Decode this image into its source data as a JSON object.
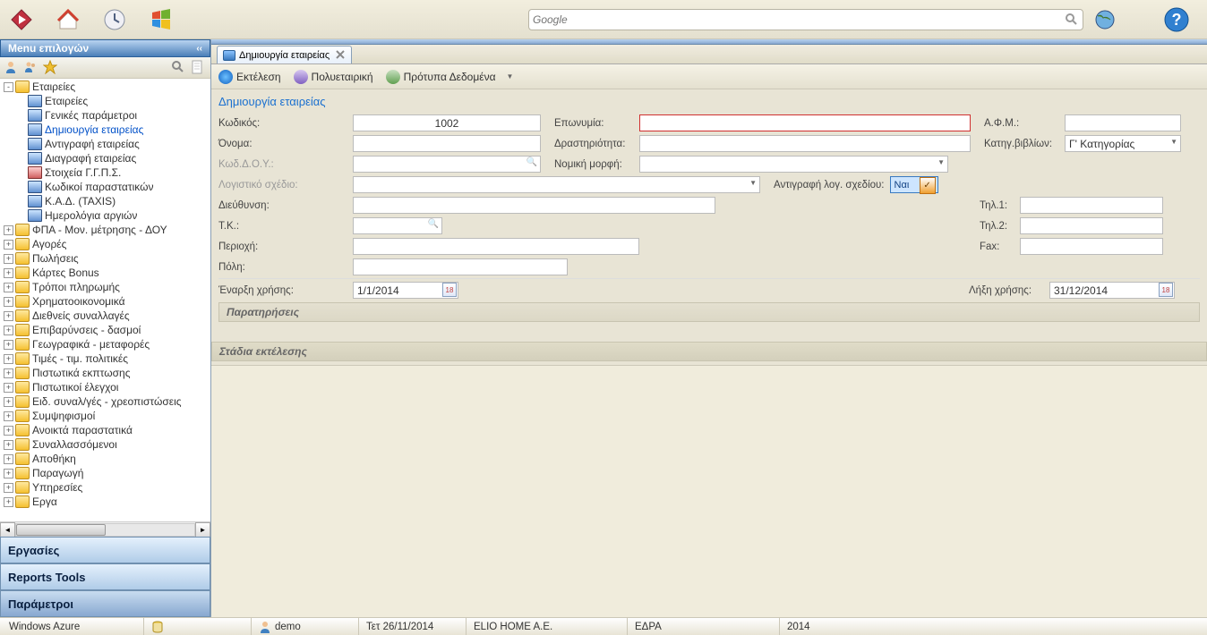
{
  "search": {
    "placeholder": "Google"
  },
  "sidebar": {
    "title": "Menu επιλογών",
    "accordion": [
      "Εργασίες",
      "Reports Tools",
      "Παράμετροι"
    ],
    "tree": [
      {
        "lvl": 1,
        "pm": "-",
        "type": "folder",
        "label": "Εταιρείες"
      },
      {
        "lvl": 2,
        "pm": "",
        "type": "doc",
        "label": "Εταιρείες"
      },
      {
        "lvl": 2,
        "pm": "",
        "type": "doc",
        "label": "Γενικές παράμετροι"
      },
      {
        "lvl": 2,
        "pm": "",
        "type": "doc",
        "label": "Δημιουργία εταιρείας",
        "selected": true
      },
      {
        "lvl": 2,
        "pm": "",
        "type": "doc",
        "label": "Αντιγραφή εταιρείας"
      },
      {
        "lvl": 2,
        "pm": "",
        "type": "doc",
        "label": "Διαγραφή εταιρείας"
      },
      {
        "lvl": 2,
        "pm": "",
        "type": "docred",
        "label": "Στοιχεία Γ.Γ.Π.Σ."
      },
      {
        "lvl": 2,
        "pm": "",
        "type": "doc",
        "label": "Κωδικοί παραστατικών"
      },
      {
        "lvl": 2,
        "pm": "",
        "type": "doc",
        "label": "Κ.Α.Δ. (TAXIS)"
      },
      {
        "lvl": 2,
        "pm": "",
        "type": "doc",
        "label": "Ημερολόγια αργιών"
      },
      {
        "lvl": 1,
        "pm": "+",
        "type": "folder",
        "label": "ΦΠΑ - Μον. μέτρησης - ΔΟΥ"
      },
      {
        "lvl": 1,
        "pm": "+",
        "type": "folder",
        "label": "Αγορές"
      },
      {
        "lvl": 1,
        "pm": "+",
        "type": "folder",
        "label": "Πωλήσεις"
      },
      {
        "lvl": 1,
        "pm": "+",
        "type": "folder",
        "label": "Κάρτες Bonus"
      },
      {
        "lvl": 1,
        "pm": "+",
        "type": "folder",
        "label": "Τρόποι πληρωμής"
      },
      {
        "lvl": 1,
        "pm": "+",
        "type": "folder",
        "label": "Χρηματοοικονομικά"
      },
      {
        "lvl": 1,
        "pm": "+",
        "type": "folder",
        "label": "Διεθνείς συναλλαγές"
      },
      {
        "lvl": 1,
        "pm": "+",
        "type": "folder",
        "label": "Επιβαρύνσεις - δασμοί"
      },
      {
        "lvl": 1,
        "pm": "+",
        "type": "folder",
        "label": "Γεωγραφικά - μεταφορές"
      },
      {
        "lvl": 1,
        "pm": "+",
        "type": "folder",
        "label": "Τιμές - τιμ. πολιτικές"
      },
      {
        "lvl": 1,
        "pm": "+",
        "type": "folder",
        "label": "Πιστωτικά εκπτωσης"
      },
      {
        "lvl": 1,
        "pm": "+",
        "type": "folder",
        "label": "Πιστωτικοί έλεγχοι"
      },
      {
        "lvl": 1,
        "pm": "+",
        "type": "folder",
        "label": "Ειδ. συναλ/γές - χρεοπιστώσεις"
      },
      {
        "lvl": 1,
        "pm": "+",
        "type": "folder",
        "label": "Συμψηφισμοί"
      },
      {
        "lvl": 1,
        "pm": "+",
        "type": "folder",
        "label": "Ανοικτά παραστατικά"
      },
      {
        "lvl": 1,
        "pm": "+",
        "type": "folder",
        "label": "Συναλλασσόμενοι"
      },
      {
        "lvl": 1,
        "pm": "+",
        "type": "folder",
        "label": "Αποθήκη"
      },
      {
        "lvl": 1,
        "pm": "+",
        "type": "folder",
        "label": "Παραγωγή"
      },
      {
        "lvl": 1,
        "pm": "+",
        "type": "folder",
        "label": "Υπηρεσίες"
      },
      {
        "lvl": 1,
        "pm": "+",
        "type": "folder",
        "label": "Εργα"
      }
    ]
  },
  "tab": {
    "title": "Δημιουργία εταιρείας"
  },
  "actions": {
    "run": "Εκτέλεση",
    "multi": "Πολυεταιρική",
    "template": "Πρότυπα Δεδομένα"
  },
  "form": {
    "title": "Δημιουργία εταιρείας",
    "labels": {
      "code": "Κωδικός:",
      "name": "Όνομα:",
      "doy": "Κωδ.Δ.Ο.Υ.:",
      "eponymia": "Επωνυμία:",
      "activity": "Δραστηριότητα:",
      "legal": "Νομική μορφή:",
      "afm": "Α.Φ.Μ.:",
      "bookcat": "Κατηγ.βιβλίων:",
      "accplan": "Λογιστικό σχέδιο:",
      "copyacc": "Αντιγραφή λογ. σχεδίου:",
      "address": "Διεύθυνση:",
      "tk": "Τ.Κ.:",
      "region": "Περιοχή:",
      "city": "Πόλη:",
      "tel1": "Τηλ.1:",
      "tel2": "Τηλ.2:",
      "fax": "Fax:",
      "start": "Έναρξη χρήσης:",
      "end": "Λήξη χρήσης:"
    },
    "values": {
      "code": "1002",
      "bookcat": "Γ' Κατηγορίας",
      "copyacc": "Ναι",
      "start": "1/1/2014",
      "end": "31/12/2014"
    },
    "sections": {
      "notes": "Παρατηρήσεις",
      "stages": "Στάδια εκτέλεσης"
    }
  },
  "status": {
    "azure": "Windows Azure",
    "user": "demo",
    "date": "Τετ 26/11/2014",
    "company": "ELIO HOME A.E.",
    "branch": "ΕΔΡΑ",
    "year": "2014"
  }
}
